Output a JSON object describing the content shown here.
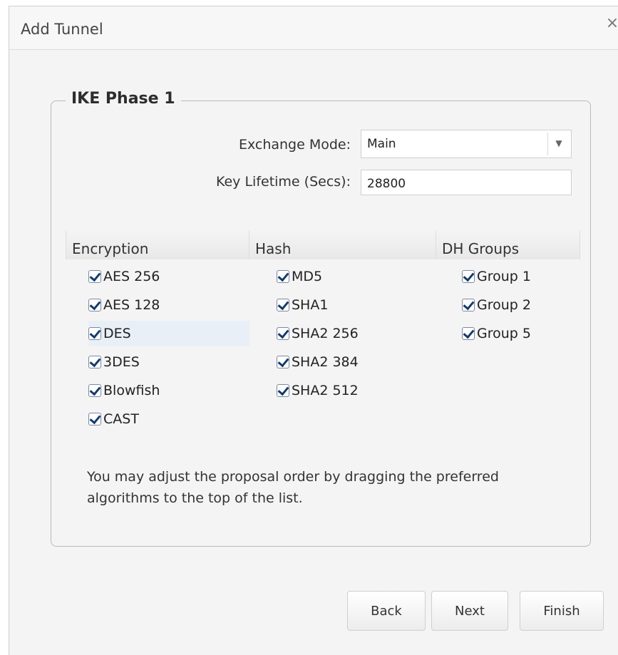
{
  "dialog": {
    "title": "Add Tunnel",
    "close_glyph": "×"
  },
  "section": {
    "legend": "IKE Phase 1",
    "exchange_mode_label": "Exchange Mode:",
    "exchange_mode_value": "Main",
    "key_lifetime_label": "Key Lifetime (Secs):",
    "key_lifetime_value": "28800"
  },
  "columns": {
    "encryption": {
      "header": "Encryption",
      "items": [
        {
          "label": "AES 256",
          "checked": true
        },
        {
          "label": "AES 128",
          "checked": true
        },
        {
          "label": "DES",
          "checked": true
        },
        {
          "label": "3DES",
          "checked": true
        },
        {
          "label": "Blowfish",
          "checked": true
        },
        {
          "label": "CAST",
          "checked": true
        }
      ]
    },
    "hash": {
      "header": "Hash",
      "items": [
        {
          "label": "MD5",
          "checked": true
        },
        {
          "label": "SHA1",
          "checked": true
        },
        {
          "label": "SHA2 256",
          "checked": true
        },
        {
          "label": "SHA2 384",
          "checked": true
        },
        {
          "label": "SHA2 512",
          "checked": true
        }
      ]
    },
    "dh_groups": {
      "header": "DH Groups",
      "items": [
        {
          "label": "Group 1",
          "checked": true
        },
        {
          "label": "Group 2",
          "checked": true
        },
        {
          "label": "Group 5",
          "checked": true
        }
      ]
    }
  },
  "note": "You may adjust the proposal order by dragging the preferred algorithms to the top of the list.",
  "buttons": {
    "back": "Back",
    "next": "Next",
    "finish": "Finish"
  },
  "icons": {
    "checkbox": "checkbox-checked-icon",
    "select": "chevron-down-icon",
    "close": "close-icon"
  }
}
